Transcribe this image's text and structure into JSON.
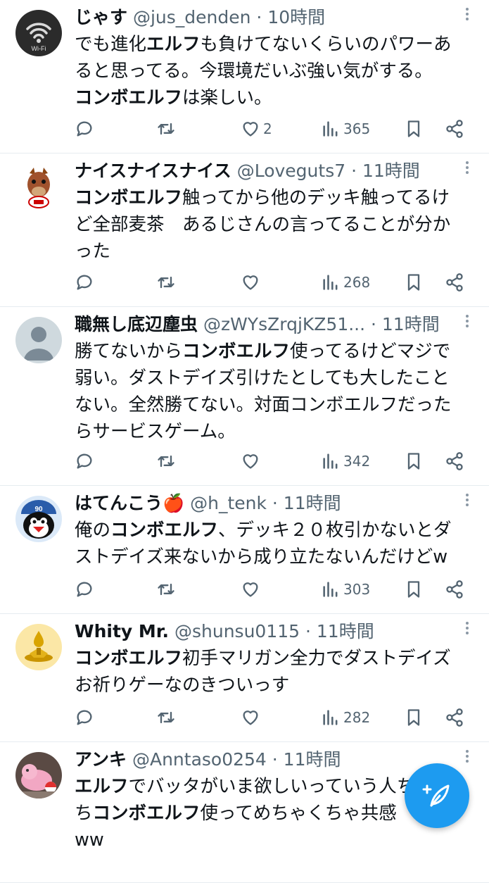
{
  "tweets": [
    {
      "name": "じゃす",
      "handle": "@jus_denden",
      "time": "10時間",
      "avatar": "wifi-avatar",
      "avatar_label": "Wi-Fi",
      "segments": [
        {
          "t": "でも進化",
          "b": false
        },
        {
          "t": "エルフ",
          "b": true
        },
        {
          "t": "も負けてないくらいのパワーあ\nると思ってる。今環境だいぶ強い気がする。\n",
          "b": false
        },
        {
          "t": "コンボエルフ",
          "b": true
        },
        {
          "t": "は楽しい。",
          "b": false
        }
      ],
      "likes": "2",
      "views": "365"
    },
    {
      "name": "ナイスナイスナイス",
      "handle": "@Loveguts7",
      "time": "11時間",
      "avatar": "horse-mascot-avatar",
      "segments": [
        {
          "t": "コンボエルフ",
          "b": true
        },
        {
          "t": "触ってから他のデッキ触ってるけ\nど全部麦茶　あるじさんの言ってることが分か\nった",
          "b": false
        }
      ],
      "likes": "",
      "views": "268"
    },
    {
      "name": "職無し底辺塵虫",
      "handle": "@zWYsZrqjKZ51...",
      "time": "11時間",
      "avatar": "default-avatar",
      "segments": [
        {
          "t": "勝てないから",
          "b": false
        },
        {
          "t": "コンボエルフ",
          "b": true
        },
        {
          "t": "使ってるけどマジで\n弱い。ダストデイズ引けたとしても大したこと\nない。全然勝てない。対面コンボエルフだった\nらサービスゲーム。",
          "b": false
        }
      ],
      "likes": "",
      "views": "342"
    },
    {
      "name": "はてんこう🍎",
      "handle": "@h_tenk",
      "time": "11時間",
      "avatar": "bird-mascot-avatar",
      "segments": [
        {
          "t": "俺の",
          "b": false
        },
        {
          "t": "コンボエルフ",
          "b": true
        },
        {
          "t": "、デッキ２０枚引かないとダ\nストデイズ来ないから成り立たないんだけどw",
          "b": false
        }
      ],
      "likes": "",
      "views": "303"
    },
    {
      "name": "Whity Mr.",
      "handle": "@shunsu0115",
      "time": "11時間",
      "avatar": "gold-drop-avatar",
      "segments": [
        {
          "t": "コンボエルフ",
          "b": true
        },
        {
          "t": "初手マリガン全力でダストデイズ\nお祈りゲーなのきついっす",
          "b": false
        }
      ],
      "likes": "",
      "views": "282"
    },
    {
      "name": "アンキ",
      "handle": "@Anntaso0254",
      "time": "11時間",
      "avatar": "pink-creature-avatar",
      "segments": [
        {
          "t": "エルフ",
          "b": true
        },
        {
          "t": "でバッタがいま欲しいっていう人",
          "b": false
        },
        {
          "t": "ち",
          "b": false
        },
        {
          "t": "\nち",
          "b": false
        },
        {
          "t": "コンボエルフ",
          "b": true
        },
        {
          "t": "使ってめちゃくちゃ共感\nww",
          "b": false
        }
      ],
      "likes": "",
      "views": ""
    }
  ],
  "separator": " · ",
  "icons": {
    "reply": "reply-icon",
    "retweet": "retweet-icon",
    "like": "heart-icon",
    "views": "views-icon",
    "bookmark": "bookmark-icon",
    "share": "share-icon",
    "compose": "compose-icon"
  },
  "colors": {
    "accent": "#1d9bf0",
    "text": "#0f1419",
    "muted": "#536471"
  }
}
